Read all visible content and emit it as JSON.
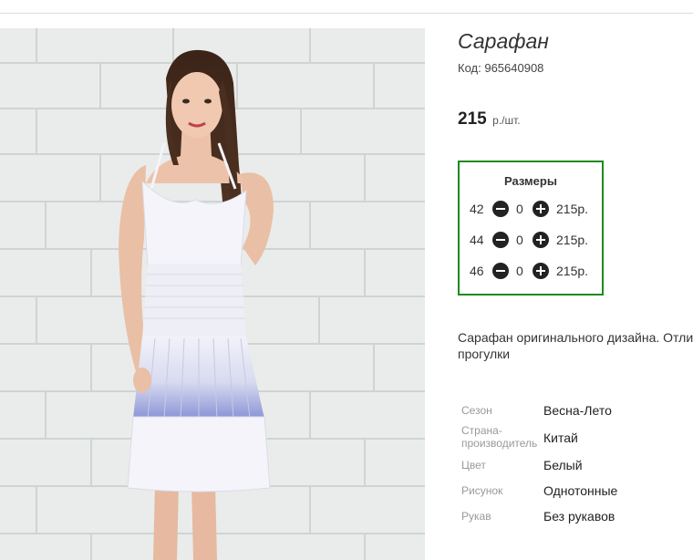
{
  "product": {
    "title": "Сарафан",
    "code_label": "Код:",
    "code": "965640908",
    "price": "215",
    "price_unit": "р./шт."
  },
  "sizes": {
    "title": "Размеры",
    "rows": [
      {
        "size": "42",
        "qty": "0",
        "price": "215р."
      },
      {
        "size": "44",
        "qty": "0",
        "price": "215р."
      },
      {
        "size": "46",
        "qty": "0",
        "price": "215р."
      }
    ]
  },
  "description": {
    "line1": "Сарафан оригинального дизайна. Отли",
    "line2": "прогулки"
  },
  "attributes": [
    {
      "label": "Сезон",
      "value": "Весна-Лето"
    },
    {
      "label_line1": "Страна-",
      "label_line2": "производитель",
      "value": "Китай"
    },
    {
      "label": "Цвет",
      "value": "Белый"
    },
    {
      "label": "Рисунок",
      "value": "Однотонные"
    },
    {
      "label": "Рукав",
      "value": "Без рукавов"
    }
  ],
  "colors": {
    "sizes_border": "#1f8a1f",
    "wall": "#e9ecea",
    "dress": "#f4f4fa",
    "dress_accent": "#8a93d6"
  }
}
